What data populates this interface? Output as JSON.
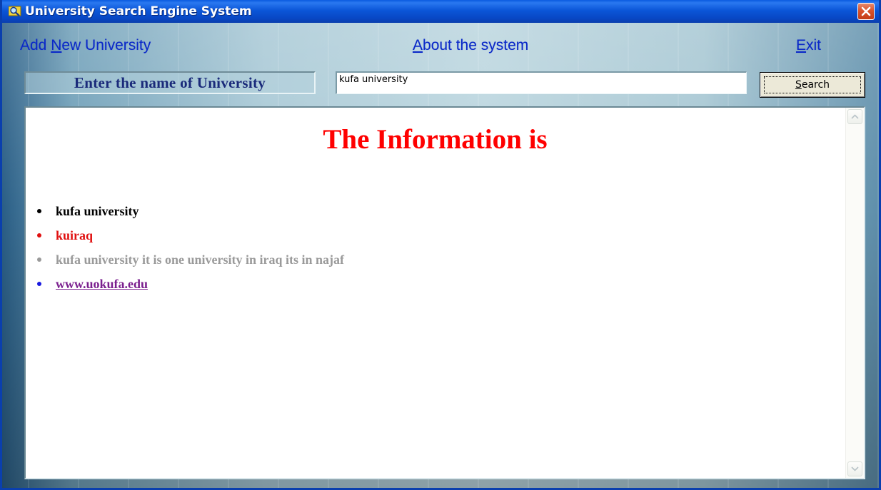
{
  "window": {
    "title": "University Search Engine System",
    "app_icon": "magnifier-app-icon",
    "close_icon": "close-icon"
  },
  "menu": {
    "add_new_university": {
      "accel": "N",
      "before": "Add ",
      "after": "ew University"
    },
    "about_the_system": {
      "accel": "A",
      "before": "",
      "after": "bout the system"
    },
    "exit": {
      "accel": "E",
      "before": "",
      "after": "xit"
    }
  },
  "search": {
    "label": "Enter the name of University",
    "value": "kufa university",
    "button": {
      "accel": "S",
      "after": "earch"
    }
  },
  "result": {
    "heading": "The Information is",
    "items": [
      {
        "text": "kufa university",
        "color": "#000000"
      },
      {
        "text": "kuiraq",
        "color": "#e01010"
      },
      {
        "text": "kufa university it is one university in iraq its in najaf",
        "color": "#9a9a9a"
      },
      {
        "text": "www.uokufa.edu",
        "color": "#7a1e8e",
        "bullet_color": "#1a1ae0"
      }
    ]
  },
  "colors": {
    "heading": "#ff0000",
    "menu_link": "#0a28c8",
    "titlebar": "#0b56d8"
  }
}
